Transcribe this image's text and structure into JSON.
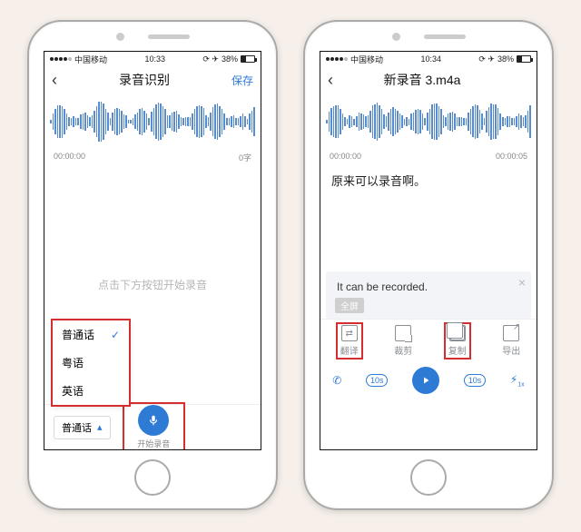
{
  "left": {
    "status": {
      "carrier": "中国移动",
      "time": "10:33",
      "battery": "38%"
    },
    "nav": {
      "title": "录音识别",
      "save": "保存"
    },
    "time_start": "00:00:00",
    "word_count": "0字",
    "hint": "点击下方按钮开始录音",
    "lang_options": [
      "普通话",
      "粤语",
      "英语"
    ],
    "lang_selected": "普通话",
    "record_label": "开始录音"
  },
  "right": {
    "status": {
      "carrier": "中国移动",
      "time": "10:34",
      "battery": "38%"
    },
    "nav": {
      "title": "新录音 3.m4a"
    },
    "time_start": "00:00:00",
    "time_end": "00:00:05",
    "transcript": "原来可以录音啊。",
    "translation": "It can be recorded.",
    "fullscreen": "全屏",
    "tools": {
      "translate": "翻译",
      "crop": "裁剪",
      "copy": "复制",
      "export": "导出"
    },
    "skip_back": "10s",
    "skip_fwd": "10s"
  }
}
